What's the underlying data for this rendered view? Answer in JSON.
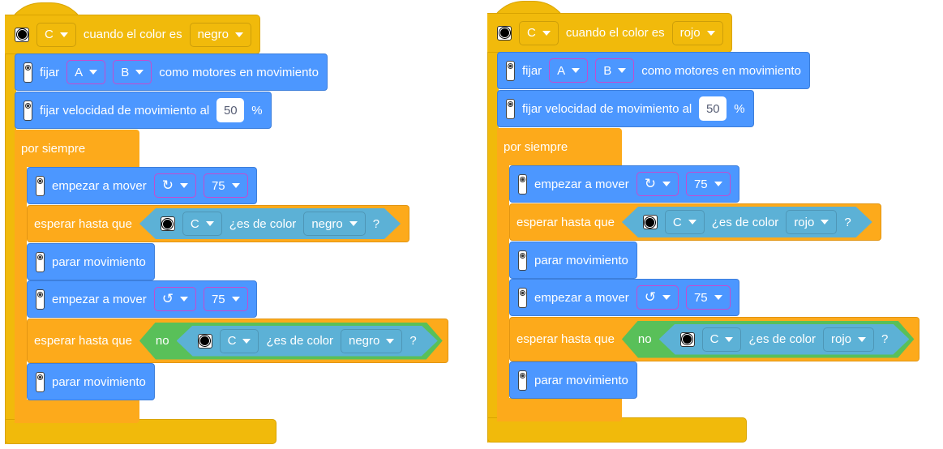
{
  "scripts": [
    {
      "hat": {
        "port": "C",
        "label": "cuando el color es",
        "color": "negro"
      },
      "set_motors": {
        "label": "fijar",
        "port_a": "A",
        "port_b": "B",
        "suffix": "como motores en movimiento"
      },
      "set_speed": {
        "label": "fijar velocidad de movimiento al",
        "value": "50",
        "unit": "%"
      },
      "forever": {
        "label": "por siempre"
      },
      "move1": {
        "label": "empezar a mover",
        "direction_icon": "↻",
        "speed": "75"
      },
      "wait1": {
        "label": "esperar hasta que",
        "port": "C",
        "question": "¿es de color",
        "color": "negro",
        "q": "?"
      },
      "stop1": {
        "label": "parar movimiento"
      },
      "move2": {
        "label": "empezar a mover",
        "direction_icon": "↺",
        "speed": "75"
      },
      "wait2": {
        "label": "esperar hasta que",
        "not": "no",
        "port": "C",
        "question": "¿es de color",
        "color": "negro",
        "q": "?"
      },
      "stop2": {
        "label": "parar movimiento"
      }
    },
    {
      "hat": {
        "port": "C",
        "label": "cuando el color es",
        "color": "rojo"
      },
      "set_motors": {
        "label": "fijar",
        "port_a": "A",
        "port_b": "B",
        "suffix": "como motores en movimiento"
      },
      "set_speed": {
        "label": "fijar velocidad de movimiento al",
        "value": "50",
        "unit": "%"
      },
      "forever": {
        "label": "por siempre"
      },
      "move1": {
        "label": "empezar a mover",
        "direction_icon": "↻",
        "speed": "75"
      },
      "wait1": {
        "label": "esperar hasta que",
        "port": "C",
        "question": "¿es de color",
        "color": "rojo",
        "q": "?"
      },
      "stop1": {
        "label": "parar movimiento"
      },
      "move2": {
        "label": "empezar a mover",
        "direction_icon": "↺",
        "speed": "75"
      },
      "wait2": {
        "label": "esperar hasta que",
        "not": "no",
        "port": "C",
        "question": "¿es de color",
        "color": "rojo",
        "q": "?"
      },
      "stop2": {
        "label": "parar movimiento"
      }
    }
  ],
  "colors": {
    "events": "#F1BA0B",
    "control": "#FDAA1B",
    "motion": "#4C97FF",
    "sensor": "#5CB1D6",
    "operator": "#59C059"
  }
}
